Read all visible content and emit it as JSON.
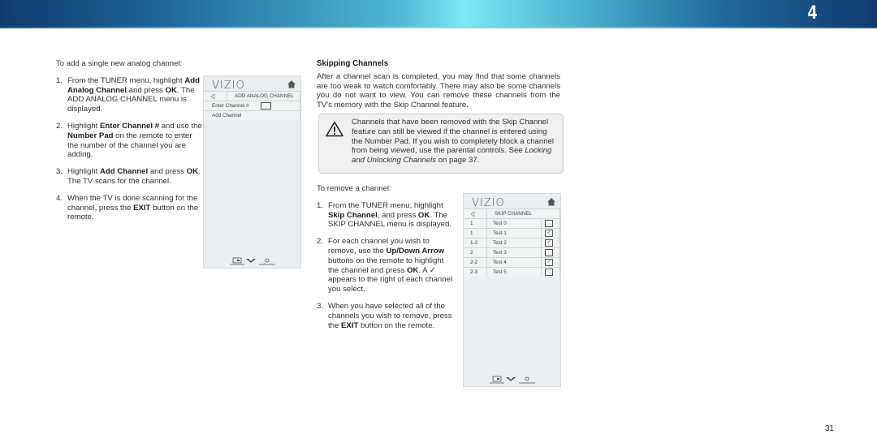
{
  "header": {
    "chapter_number": "4"
  },
  "left_column": {
    "intro": "To add a single new analog channel:",
    "steps": [
      {
        "num": "1.",
        "parts": [
          "From the TUNER menu, highlight ",
          {
            "b": "Add Analog Channel"
          },
          " and press ",
          {
            "b": "OK"
          },
          ". The ADD ANALOG CHANNEL menu is displayed."
        ]
      },
      {
        "num": "2.",
        "parts": [
          "Highlight ",
          {
            "b": "Enter Channel #"
          },
          " and use the ",
          {
            "b": "Number Pad"
          },
          " on the remote to enter the number of the channel you are adding."
        ]
      },
      {
        "num": "3.",
        "parts": [
          "Highlight ",
          {
            "b": "Add Channel"
          },
          " and press ",
          {
            "b": "OK"
          },
          ". The TV scans for the channel."
        ]
      },
      {
        "num": "4.",
        "parts": [
          "When the TV is done scanning for the channel, press the ",
          {
            "b": "EXIT"
          },
          " button on the remote."
        ]
      }
    ]
  },
  "panel_add": {
    "logo": "VIZIO",
    "title": "ADD ANALOG CHANNEL",
    "items": [
      "Enter Channel #",
      "Add Channel"
    ]
  },
  "skipping": {
    "heading": "Skipping Channels",
    "paragraph": "After a channel scan is completed, you may find that some channels are too weak to watch comfortably. There may also be some channels you do not want to view. You can remove these channels from the TV's memory with the Skip Channel feature.",
    "note": {
      "icon": "warning-icon",
      "text_before": "Channels that have been removed with the Skip Channel feature can still be viewed if the channel is entered using the Number Pad. If you wish to completely block a channel from being viewed, use the parental controls. See ",
      "italic": "Locking and Unlocking Channels",
      "text_after": " on page 37."
    },
    "intro": "To remove a channel:",
    "steps": [
      {
        "num": "1.",
        "parts": [
          "From the TUNER menu, highlight ",
          {
            "b": "Skip Channel"
          },
          ", and press ",
          {
            "b": "OK"
          },
          ". The SKIP CHANNEL menu is displayed."
        ]
      },
      {
        "num": "2.",
        "parts": [
          "For each channel you wish to remove, use the ",
          {
            "b": "Up/Down Arrow"
          },
          " buttons on the remote to highlight the channel and press ",
          {
            "b": "OK"
          },
          ". A ✓ appears to the right of each channel you select."
        ]
      },
      {
        "num": "3.",
        "parts": [
          "When you have selected all of the channels you wish to remove, press the ",
          {
            "b": "EXIT"
          },
          " button on the remote."
        ]
      }
    ]
  },
  "panel_skip": {
    "logo": "VIZIO",
    "title": "SKIP CHANNEL",
    "rows": [
      {
        "channel": "1",
        "name": "Test 0",
        "checked": false
      },
      {
        "channel": "1",
        "name": "Test 1",
        "checked": true
      },
      {
        "channel": "1-2",
        "name": "Test 2",
        "checked": true
      },
      {
        "channel": "2",
        "name": "Test 3",
        "checked": false
      },
      {
        "channel": "2-2",
        "name": "Test 4",
        "checked": true
      },
      {
        "channel": "2-3",
        "name": "Test 5",
        "checked": false
      }
    ]
  },
  "footer": {
    "page_number": "31"
  }
}
